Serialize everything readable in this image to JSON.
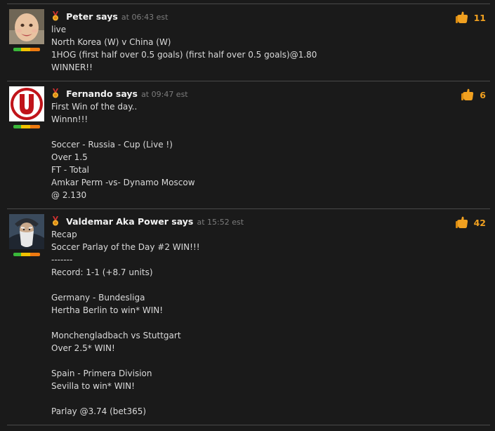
{
  "colors": {
    "background": "#1a1a1a",
    "text": "#dadada",
    "author": "#f2f2f2",
    "time": "#7c7c7c",
    "like_count": "#f0a020",
    "divider": "#4a4a4a",
    "rating_green": "#3ab83a",
    "rating_yellow": "#f2c200",
    "rating_orange": "#ee7a10"
  },
  "icons": {
    "badge": "medal-icon",
    "like": "thumbs-up-icon"
  },
  "comments": [
    {
      "author": "Peter says",
      "time": "at 06:43 est",
      "likes": "11",
      "avatar": "baby-face-avatar",
      "lines": [
        "live",
        "North Korea (W) v China (W)",
        "1HOG (first half over 0.5 goals) (first half over 0.5 goals)@1.80",
        "WINNER!!"
      ]
    },
    {
      "author": "Fernando says",
      "time": "at 09:47 est",
      "likes": "6",
      "avatar": "red-u-logo-avatar",
      "lines": [
        "First Win of the day..",
        "Winnn!!!",
        "",
        "Soccer - Russia - Cup (Live !)",
        "Over 1.5",
        "FT - Total",
        "Amkar Perm -vs- Dynamo Moscow",
        "@ 2.130"
      ]
    },
    {
      "author": "Valdemar Aka Power says",
      "time": "at 15:52 est",
      "likes": "42",
      "avatar": "bearded-wizard-avatar",
      "lines": [
        "Recap",
        "Soccer Parlay of the Day #2 WIN!!!",
        "-------",
        "Record: 1-1 (+8.7 units)",
        "",
        "Germany - Bundesliga",
        "Hertha Berlin to win* WIN!",
        "",
        "Monchengladbach vs Stuttgart",
        "Over 2.5* WIN!",
        "",
        "Spain - Primera Division",
        "Sevilla to win* WIN!",
        "",
        "Parlay @3.74 (bet365)"
      ]
    }
  ]
}
